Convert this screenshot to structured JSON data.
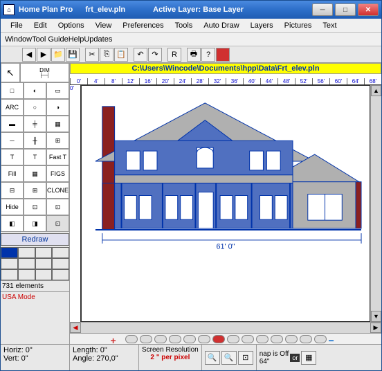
{
  "titlebar": {
    "app_name": "Home Plan Pro",
    "file_name": "frt_elev.pln",
    "active_layer_label": "Active Layer: Base Layer"
  },
  "menu": {
    "items": [
      "File",
      "Edit",
      "Options",
      "View",
      "Preferences",
      "Tools",
      "Auto Draw",
      "Layers",
      "Pictures",
      "Text"
    ],
    "items2": [
      "Window",
      "Tool Guide",
      "Help",
      "Updates"
    ]
  },
  "path_bar": "C:\\Users\\Wincode\\Documents\\hpp\\Data\\Frt_elev.pln",
  "ruler_ticks": [
    "0'",
    "4'",
    "8'",
    "12'",
    "16'",
    "20'",
    "24'",
    "28'",
    "32'",
    "36'",
    "40'",
    "44'",
    "48'",
    "52'",
    "56'",
    "60'",
    "64'",
    "68'"
  ],
  "left_panel": {
    "dim_label": "DIM",
    "tool_labels": [
      "□",
      "◐",
      "▭",
      "ARC",
      "○",
      "◑",
      "▬",
      "╪",
      "▦",
      "─",
      "╫",
      "⊞",
      "T",
      "T",
      "Fast T",
      "Fill",
      "▦",
      "FIGS",
      "⊟",
      "⊞",
      "CLONE",
      "Hide",
      "⊡",
      "⊡",
      "◧",
      "◨",
      "⊡"
    ],
    "redraw": "Redraw",
    "elements": "731 elements",
    "usa": "USA Mode"
  },
  "drawing": {
    "dimension": "61' 0\""
  },
  "status": {
    "horiz": "Horiz: 0\"",
    "vert": "Vert: 0\"",
    "length": "Length: 0\"",
    "angle": "Angle: 270,0\"",
    "screen_res": "Screen Resolution",
    "per_pixel": "2 \" per pixel",
    "snap": "nap is Off",
    "snap_val": "64\"",
    "or": "or"
  },
  "icons": {
    "minimize": "─",
    "maximize": "□",
    "close": "✕"
  }
}
